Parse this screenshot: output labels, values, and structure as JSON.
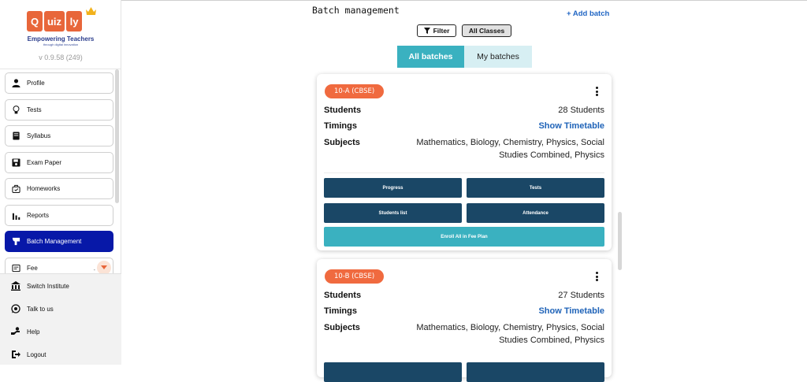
{
  "brand": {
    "logo_tiles": [
      "Q",
      "uiz",
      "ly"
    ],
    "tagline": "Empowering Teachers",
    "subtagline": "through digital innovation",
    "version": "v 0.9.58 (249)"
  },
  "sidebar": {
    "items": [
      {
        "label": "Profile",
        "icon": "person-icon"
      },
      {
        "label": "Tests",
        "icon": "lightbulb-icon"
      },
      {
        "label": "Syllabus",
        "icon": "book-icon"
      },
      {
        "label": "Exam Paper",
        "icon": "save-icon"
      },
      {
        "label": "Homeworks",
        "icon": "bag-icon"
      },
      {
        "label": "Reports",
        "icon": "bar-chart-icon"
      },
      {
        "label": "Batch Management",
        "icon": "batch-icon",
        "active": true
      },
      {
        "label": "Fee",
        "icon": "receipt-icon",
        "dropdown": true
      }
    ],
    "bottom": [
      {
        "label": "Switch Institute",
        "icon": "institute-icon"
      },
      {
        "label": "Talk to us",
        "icon": "whatsapp-icon"
      },
      {
        "label": "Help",
        "icon": "help-hand-icon"
      },
      {
        "label": "Logout",
        "icon": "logout-icon"
      }
    ]
  },
  "header": {
    "title": "Batch management",
    "add_batch": "+ Add batch",
    "filter": "Filter",
    "all_classes": "All Classes"
  },
  "tabs": [
    {
      "label": "All batches",
      "active": true
    },
    {
      "label": "My batches",
      "active": false
    }
  ],
  "labels": {
    "students": "Students",
    "timings": "Timings",
    "subjects": "Subjects"
  },
  "batches": [
    {
      "name": "10-A (CBSE)",
      "students": "28 Students",
      "timings": "Show Timetable",
      "subjects_line1": "Mathematics, Biology, Chemistry, Physics, Social",
      "subjects_line2": "Studies Combined, Physics",
      "actions": {
        "progress": "Progress",
        "tests": "Tests",
        "students_list": "Students list",
        "attendance": "Attendance",
        "enroll": "Enroll All in Fee Plan"
      }
    },
    {
      "name": "10-B (CBSE)",
      "students": "27 Students",
      "timings": "Show Timetable",
      "subjects_line1": "Mathematics, Biology, Chemistry, Physics, Social",
      "subjects_line2": "Studies Combined, Physics"
    }
  ],
  "colors": {
    "brand_orange": "#e8663a",
    "active_nav": "#0718a8",
    "teal": "#3ab1c0",
    "navy_button": "#1a4766",
    "badge": "#f06a3f",
    "link_blue": "#1f63b8"
  }
}
